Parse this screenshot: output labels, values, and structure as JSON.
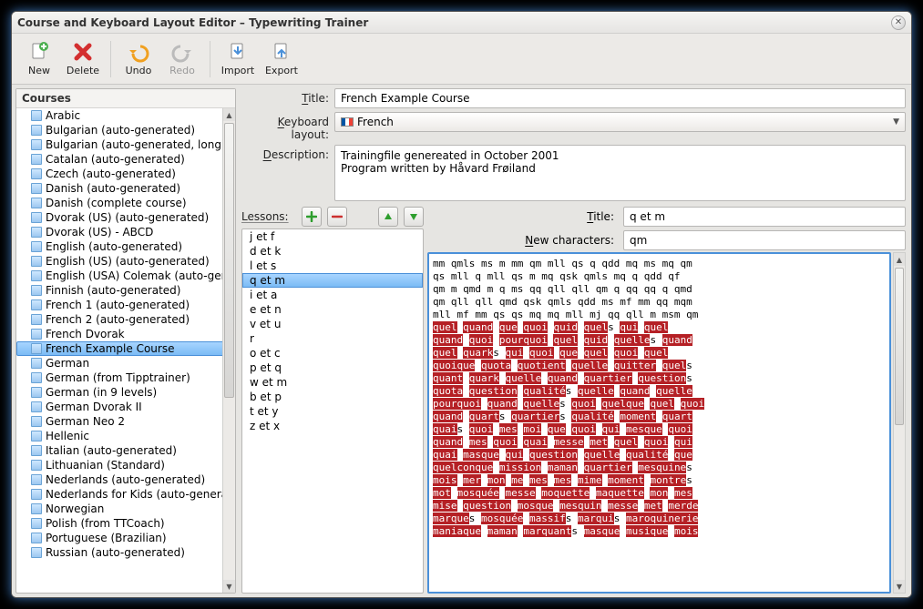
{
  "window": {
    "title": "Course and Keyboard Layout Editor – Typewriting Trainer"
  },
  "toolbar": {
    "new": "New",
    "delete": "Delete",
    "undo": "Undo",
    "redo": "Redo",
    "import": "Import",
    "export": "Export"
  },
  "courses": {
    "header": "Courses",
    "items": [
      "Arabic",
      "Bulgarian (auto-generated)",
      "Bulgarian (auto-generated, long)",
      "Catalan (auto-generated)",
      "Czech (auto-generated)",
      "Danish (auto-generated)",
      "Danish (complete course)",
      "Dvorak (US) (auto-generated)",
      "Dvorak (US) - ABCD",
      "English (auto-generated)",
      "English (US) (auto-generated)",
      "English (USA) Colemak (auto-gen…",
      "Finnish (auto-generated)",
      "French 1 (auto-generated)",
      "French 2 (auto-generated)",
      "French Dvorak",
      "French Example Course",
      "German",
      "German (from Tipptrainer)",
      "German (in 9 levels)",
      "German Dvorak II",
      "German Neo 2",
      "Hellenic",
      "Italian (auto-generated)",
      "Lithuanian (Standard)",
      "Nederlands (auto-generated)",
      "Nederlands for Kids (auto-genera…",
      "Norwegian",
      "Polish (from TTCoach)",
      "Portuguese (Brazilian)",
      "Russian (auto-generated)"
    ],
    "selected_index": 16
  },
  "form": {
    "title_label": "Title:",
    "title_value": "French Example Course",
    "kb_label": "Keyboard layout:",
    "kb_value": "French",
    "desc_label": "Description:",
    "desc_value": "Trainingfile genereated in October 2001\nProgram written by Håvard Frøiland"
  },
  "lessons": {
    "label": "Lessons:",
    "items": [
      "j et f",
      "d et k",
      "l et s",
      "q et m",
      "i et a",
      "e et n",
      "v et u",
      "r",
      "o et c",
      "p et q",
      "w et m",
      "b et p",
      "t et y",
      "z et x"
    ],
    "selected_index": 3
  },
  "lesson_detail": {
    "title_label": "Title:",
    "title_value": "q et m",
    "new_chars_label": "New characters:",
    "new_chars_value": "qm",
    "plain_lines": [
      "mm qmls ms m mm qm mll qs q qdd mq ms mq qm",
      "qs mll q mll qs m mq qsk qmls mq q qdd qf",
      "qm m qmd m q ms qq qll qll qm q qq qq q qmd",
      "qm qll qll qmd qsk qmls qdd ms mf mm qq mqm",
      "mll mf mm qs qs mq mq mll mj qq qll m msm qm"
    ]
  }
}
